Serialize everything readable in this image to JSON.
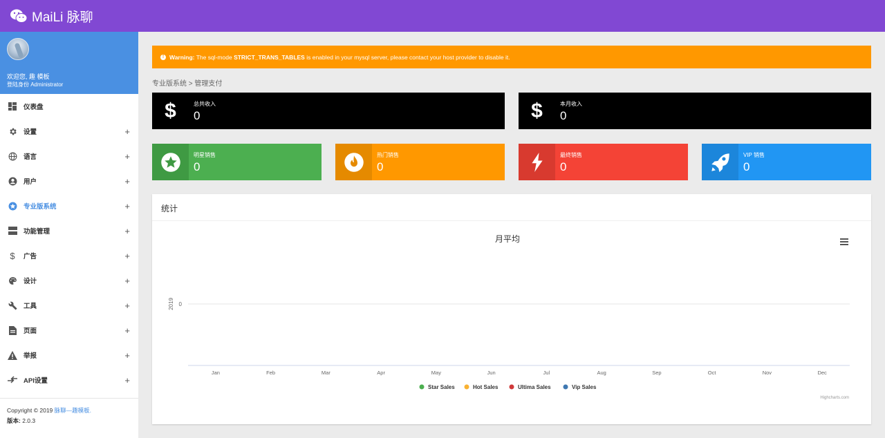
{
  "app": {
    "brand": "MaiLi 脉聊"
  },
  "profile": {
    "welcome": "欢迎您, 趣 模板",
    "role": "登陆身份 Administrator"
  },
  "menu": [
    {
      "label": "仪表盘",
      "icon": "dashboard-icon",
      "plus": ""
    },
    {
      "label": "设置",
      "icon": "gear-icon",
      "plus": "+"
    },
    {
      "label": "语言",
      "icon": "globe-icon",
      "plus": "+"
    },
    {
      "label": "用户",
      "icon": "user-icon",
      "plus": "+"
    },
    {
      "label": "专业版系统",
      "icon": "star-circle-icon",
      "plus": "+"
    },
    {
      "label": "功能管理",
      "icon": "server-icon",
      "plus": "+"
    },
    {
      "label": "广告",
      "icon": "dollar-icon",
      "plus": "+"
    },
    {
      "label": "设计",
      "icon": "palette-icon",
      "plus": "+"
    },
    {
      "label": "工具",
      "icon": "wrench-icon",
      "plus": "+"
    },
    {
      "label": "页面",
      "icon": "page-icon",
      "plus": "+"
    },
    {
      "label": "举报",
      "icon": "warning-icon",
      "plus": "+"
    },
    {
      "label": "API设置",
      "icon": "api-icon",
      "plus": "+"
    }
  ],
  "footer": {
    "copyright_prefix": "Copyright © 2019 ",
    "copyright_link": "脉聊—趣模板.",
    "version_label": "版本:",
    "version": "2.0.3"
  },
  "warning": {
    "title": "Warning:",
    "text1": " The sql-mode ",
    "bold": "STRICT_TRANS_TABLES",
    "text2": " is enabled in your mysql server, please contact your host provider to disable it."
  },
  "breadcrumb": "专业版系统 > 管理支付",
  "stats_top": [
    {
      "label": "总共收入",
      "value": "0",
      "icon": "dollar-icon",
      "color": "#000000"
    },
    {
      "label": "本月收入",
      "value": "0",
      "icon": "dollar-icon",
      "color": "#000000"
    }
  ],
  "stats_bottom": [
    {
      "label": "明星销售",
      "value": "0",
      "icon": "star-circle-icon",
      "color": "#4caf50",
      "dark": "#3f9a43"
    },
    {
      "label": "热门销售",
      "value": "0",
      "icon": "flame-icon",
      "color": "#ff9800",
      "dark": "#e58a00"
    },
    {
      "label": "最终销售",
      "value": "0",
      "icon": "bolt-icon",
      "color": "#f44336",
      "dark": "#d83a2f"
    },
    {
      "label": "VIP 销售",
      "value": "0",
      "icon": "rocket-icon",
      "color": "#2196f3",
      "dark": "#1c86db"
    }
  ],
  "panel": {
    "title": "统计"
  },
  "chart_data": {
    "type": "line",
    "title": "月平均",
    "categories": [
      "Jan",
      "Feb",
      "Mar",
      "Apr",
      "May",
      "Jun",
      "Jul",
      "Aug",
      "Sep",
      "Oct",
      "Nov",
      "Dec"
    ],
    "ylabel": "2019",
    "yticks": [
      "0"
    ],
    "series": [
      {
        "name": "Star Sales",
        "color": "#4caf50",
        "values": []
      },
      {
        "name": "Hot Sales",
        "color": "#f9b233",
        "values": []
      },
      {
        "name": "Ultima Sales",
        "color": "#d0393a",
        "values": []
      },
      {
        "name": "Vip Sales",
        "color": "#3f78b1",
        "values": []
      }
    ],
    "credit": "Highcharts.com",
    "legend_position": "bottom-center"
  }
}
